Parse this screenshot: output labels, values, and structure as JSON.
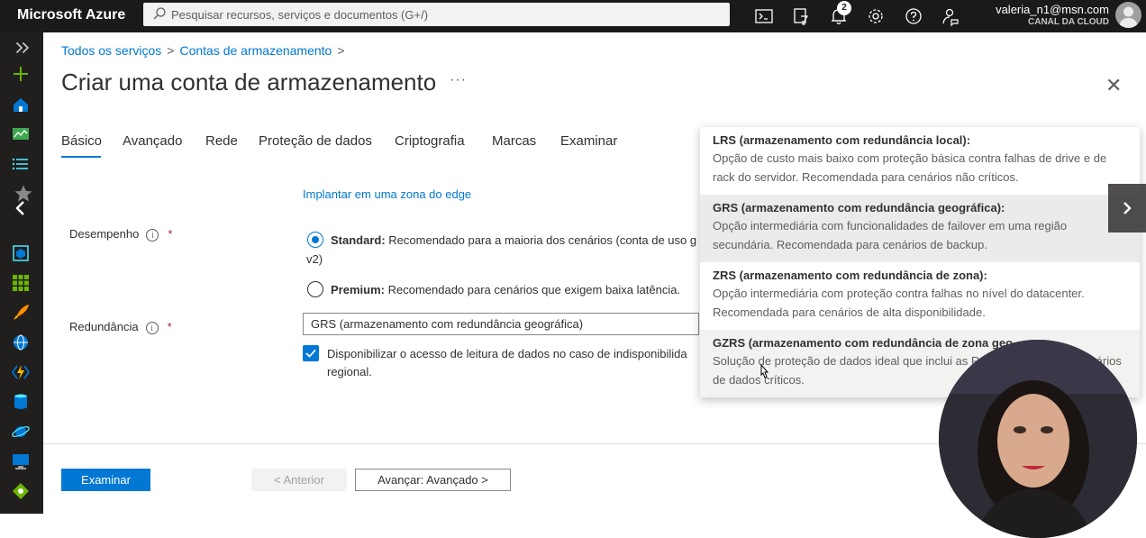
{
  "topbar": {
    "brand": "Microsoft Azure",
    "search_placeholder": "Pesquisar recursos, serviços e documentos (G+/)",
    "notification_count": "2",
    "account_email": "valeria_n1@msn.com",
    "account_directory": "CANAL DA CLOUD"
  },
  "breadcrumb": {
    "items": [
      "Todos os serviços",
      "Contas de armazenamento"
    ],
    "separator": ">"
  },
  "page": {
    "title": "Criar uma conta de armazenamento",
    "more": "···",
    "close": "✕"
  },
  "tabs": [
    {
      "label": "Básico",
      "active": true
    },
    {
      "label": "Avançado"
    },
    {
      "label": "Rede"
    },
    {
      "label": "Proteção de dados"
    },
    {
      "label": "Criptografia"
    },
    {
      "label": "Marcas"
    },
    {
      "label": "Examinar"
    }
  ],
  "form": {
    "edge_link": "Implantar em uma zona do edge",
    "performance_label": "Desempenho",
    "required_mark": "*",
    "info_glyph": "i",
    "standard_bold": "Standard:",
    "standard_text": "Recomendado para a maioria dos cenários (conta de uso g",
    "standard_wrap": "v2)",
    "premium_bold": "Premium:",
    "premium_text": "Recomendado para cenários que exigem baixa latência.",
    "redundancy_label": "Redundância",
    "redundancy_value": "GRS (armazenamento com redundância geográfica)",
    "readaccess_text": "Disponibilizar o acesso de leitura de dados no caso de indisponibilida regional."
  },
  "footer": {
    "review_button": "Examinar",
    "previous_button": "< Anterior",
    "next_button": "Avançar: Avançado >"
  },
  "dropdown": {
    "options": [
      {
        "title": "LRS (armazenamento com redundância local):",
        "desc": "Opção de custo mais baixo com proteção básica contra falhas de drive e de rack do servidor. Recomendada para cenários não críticos."
      },
      {
        "title": "GRS (armazenamento com redundância geográfica):",
        "desc": "Opção intermediária com funcionalidades de failover em uma região secundária. Recomendada para cenários de backup."
      },
      {
        "title": "ZRS (armazenamento com redundância de zona):",
        "desc": "Opção intermediária com proteção contra falhas no nível do datacenter. Recomendada para cenários de alta disponibilidade."
      },
      {
        "title": "GZRS (armazenamento com redundância de zona geo",
        "desc": "Solução de proteção de dados ideal que inclui as Recomendada para cenários de dados críticos."
      }
    ]
  },
  "colors": {
    "accent": "#0078d4",
    "topbar": "#1b1a19",
    "leftnav": "#201f1e"
  }
}
